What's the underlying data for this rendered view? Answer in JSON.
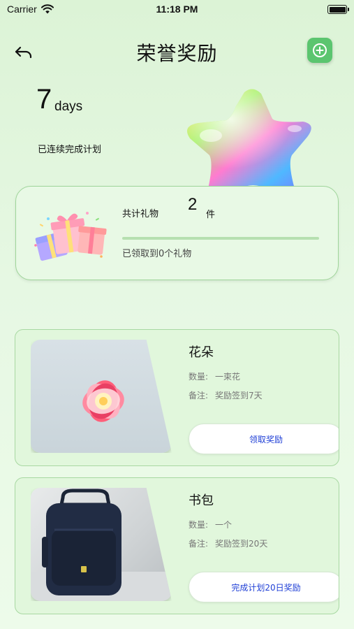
{
  "status_bar": {
    "carrier": "Carrier",
    "time": "11:18 PM",
    "battery_level": 1.0
  },
  "header": {
    "title": "荣誉奖励",
    "back_icon": "back-arrow-icon",
    "add_icon": "plus-circle-icon",
    "accent": "#5bc56f"
  },
  "streak": {
    "count": "7",
    "unit": "days",
    "label": "已连续完成计划"
  },
  "summary": {
    "total_label": "共计礼物",
    "total_count": "2",
    "total_unit": "件",
    "received_text": "已领取到0个礼物",
    "progress": 0
  },
  "rewards": [
    {
      "name": "花朵",
      "qty_label": "数量:",
      "qty_value": "一束花",
      "note_label": "备注:",
      "note_value": "奖励签到7天",
      "button": "领取奖励"
    },
    {
      "name": "书包",
      "qty_label": "数量:",
      "qty_value": "一个",
      "note_label": "备注:",
      "note_value": "奖励签到20天",
      "button": "完成计划20日奖励"
    }
  ]
}
